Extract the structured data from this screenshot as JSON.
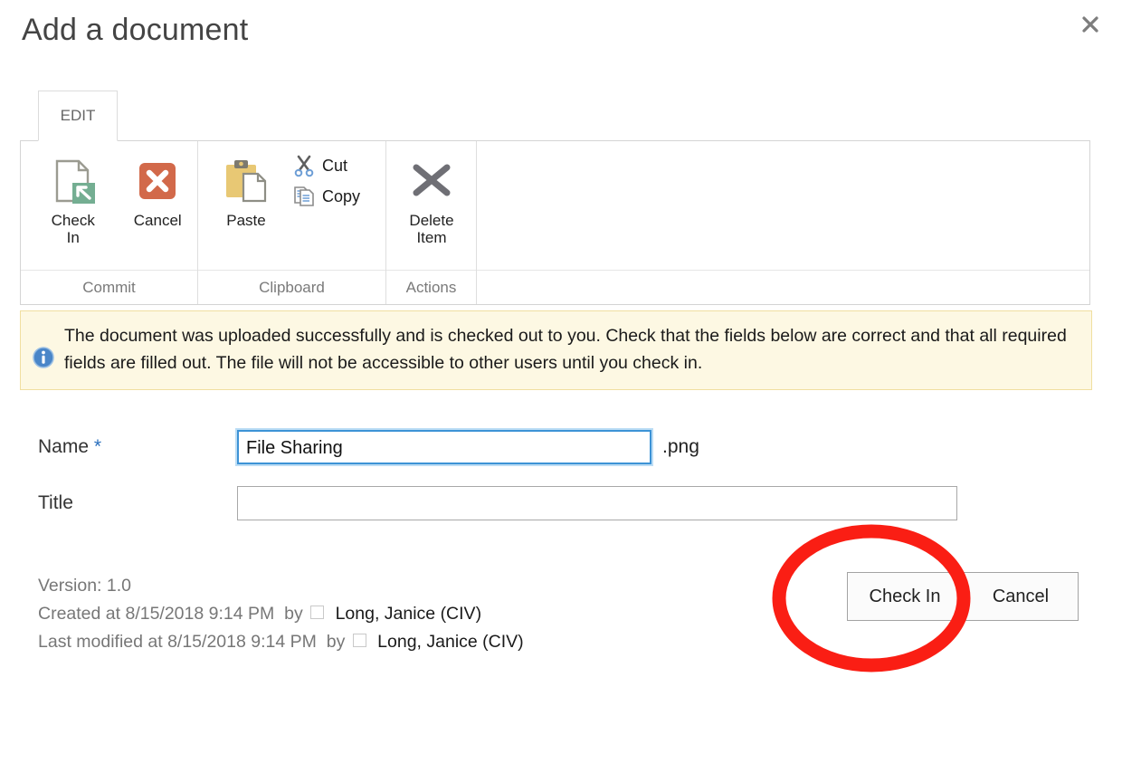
{
  "dialog": {
    "title": "Add a document",
    "close_icon": "close-x-icon"
  },
  "ribbon": {
    "tabs": [
      {
        "label": "EDIT",
        "active": true
      }
    ],
    "groups": [
      {
        "name": "Commit",
        "label": "Commit",
        "items": [
          {
            "label": "Check\nIn",
            "label_line1": "Check",
            "label_line2": "In",
            "icon": "check-in-document-icon",
            "size": "large"
          },
          {
            "label": "Cancel",
            "icon": "cancel-red-x-icon",
            "size": "large"
          }
        ]
      },
      {
        "name": "Clipboard",
        "label": "Clipboard",
        "items": [
          {
            "label": "Paste",
            "icon": "paste-clipboard-icon",
            "size": "large"
          },
          {
            "label": "Cut",
            "icon": "cut-scissors-icon",
            "size": "small"
          },
          {
            "label": "Copy",
            "icon": "copy-pages-icon",
            "size": "small"
          }
        ]
      },
      {
        "name": "Actions",
        "label": "Actions",
        "items": [
          {
            "label": "Delete\nItem",
            "label_line1": "Delete",
            "label_line2": "Item",
            "icon": "delete-item-x-icon",
            "size": "large"
          }
        ]
      }
    ]
  },
  "notification": {
    "icon": "info-icon",
    "text": "The document was uploaded successfully and is checked out to you. Check that the fields below are correct and that all required fields are filled out. The file will not be accessible to other users until you check in.",
    "background_color": "#fdf8e3",
    "border_color": "#f0dfa0"
  },
  "form": {
    "name": {
      "label": "Name",
      "required_marker": "*",
      "value": "File Sharing",
      "placeholder": "",
      "extension": ".png",
      "focused": true
    },
    "title": {
      "label": "Title",
      "value": "",
      "placeholder": ""
    }
  },
  "metadata": {
    "version_line": "Version: 1.0",
    "created_prefix": "Created at 8/15/2018 9:14 PM",
    "created_by_word": "by",
    "created_by": "Long, Janice (CIV)",
    "modified_prefix": "Last modified at 8/15/2018 9:14 PM",
    "modified_by_word": "by",
    "modified_by": "Long, Janice (CIV)"
  },
  "actions": {
    "check_in_label": "Check In",
    "cancel_label": "Cancel"
  },
  "annotation": {
    "shape": "ellipse-highlight",
    "target": "Check In",
    "color": "#FA1E14"
  }
}
